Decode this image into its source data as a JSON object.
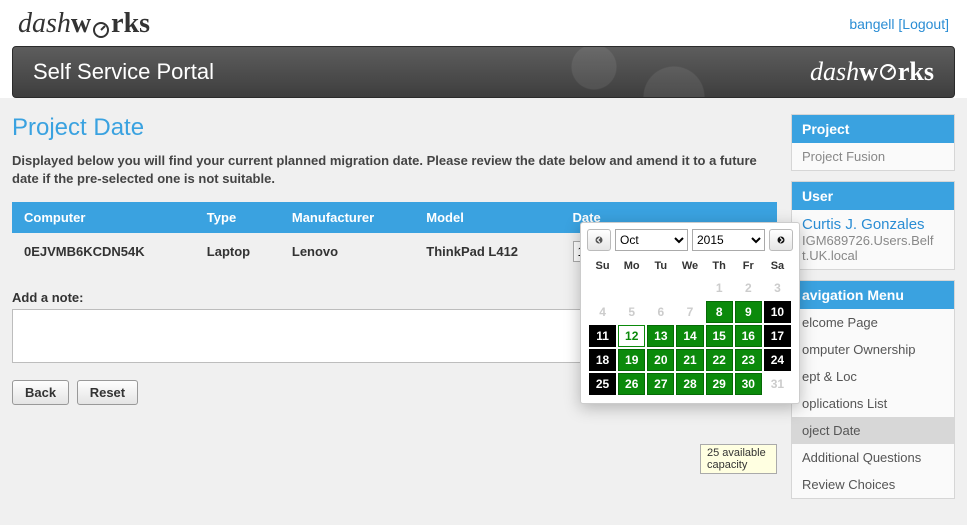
{
  "header": {
    "brand_prefix": "dash",
    "brand_first": "w",
    "brand_rest": "rks",
    "username": "bangell",
    "logout": "Logout"
  },
  "banner": {
    "title": "Self Service Portal"
  },
  "page": {
    "title": "Project Date",
    "intro": "Displayed below you will find your current planned migration date. Please review the date below and amend it to a future date if the pre-selected one is not suitable."
  },
  "grid": {
    "columns": [
      "Computer",
      "Type",
      "Manufacturer",
      "Model",
      "Date"
    ],
    "row": {
      "computer": "0EJVMB6KCDN54K",
      "type": "Laptop",
      "manufacturer": "Lenovo",
      "model": "ThinkPad L412",
      "date_value": "12 Oct 2015"
    }
  },
  "note": {
    "label": "Add a note:",
    "value": ""
  },
  "buttons": {
    "back": "Back",
    "reset": "Reset"
  },
  "sidebar": {
    "project_head": "Project",
    "project_name": "Project Fusion",
    "user_head": "User",
    "user_name": "Curtis J. Gonzales",
    "user_dn1": "IGM689726.Users.Belf",
    "user_dn2": "t.UK.local",
    "nav_head": "avigation Menu",
    "nav": [
      "elcome Page",
      "omputer Ownership",
      "ept & Loc",
      "oplications List",
      "oject Date",
      "Additional Questions",
      "Review Choices"
    ],
    "nav_active_index": 4
  },
  "datepicker": {
    "month": "Oct",
    "year": "2015",
    "dows": [
      "Su",
      "Mo",
      "Tu",
      "We",
      "Th",
      "Fr",
      "Sa"
    ],
    "cells": [
      {
        "n": "",
        "c": "dis"
      },
      {
        "n": "",
        "c": "dis"
      },
      {
        "n": "",
        "c": "dis"
      },
      {
        "n": "",
        "c": "dis"
      },
      {
        "n": "1",
        "c": "dis"
      },
      {
        "n": "2",
        "c": "dis"
      },
      {
        "n": "3",
        "c": "dis"
      },
      {
        "n": "4",
        "c": "dis"
      },
      {
        "n": "5",
        "c": "dis"
      },
      {
        "n": "6",
        "c": "dis"
      },
      {
        "n": "7",
        "c": "dis"
      },
      {
        "n": "8",
        "c": "g"
      },
      {
        "n": "9",
        "c": "g"
      },
      {
        "n": "10",
        "c": "k"
      },
      {
        "n": "11",
        "c": "k"
      },
      {
        "n": "12",
        "c": "sel"
      },
      {
        "n": "13",
        "c": "g"
      },
      {
        "n": "14",
        "c": "g"
      },
      {
        "n": "15",
        "c": "g"
      },
      {
        "n": "16",
        "c": "g"
      },
      {
        "n": "17",
        "c": "k"
      },
      {
        "n": "18",
        "c": "k"
      },
      {
        "n": "19",
        "c": "g"
      },
      {
        "n": "20",
        "c": "g"
      },
      {
        "n": "21",
        "c": "g"
      },
      {
        "n": "22",
        "c": "g"
      },
      {
        "n": "23",
        "c": "g"
      },
      {
        "n": "24",
        "c": "k"
      },
      {
        "n": "25",
        "c": "k"
      },
      {
        "n": "26",
        "c": "g"
      },
      {
        "n": "27",
        "c": "g"
      },
      {
        "n": "28",
        "c": "g"
      },
      {
        "n": "29",
        "c": "g"
      },
      {
        "n": "30",
        "c": "g"
      },
      {
        "n": "31",
        "c": "dis"
      }
    ],
    "tooltip": "25 available capacity"
  }
}
